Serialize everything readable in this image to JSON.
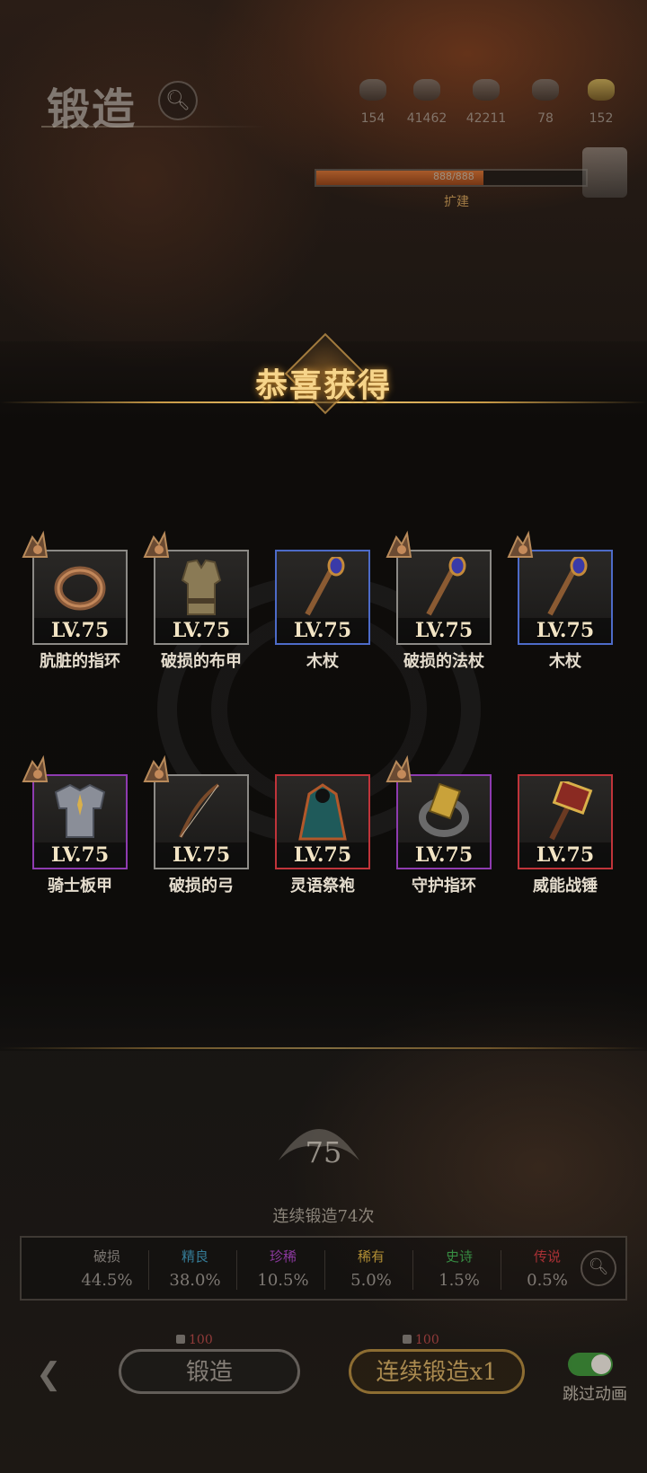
{
  "header": {
    "title": "锻造",
    "resources": [
      {
        "icon": "ore-icon",
        "value": "154"
      },
      {
        "icon": "ingot-icon",
        "value": "41462"
      },
      {
        "icon": "stone-icon",
        "value": "42211"
      },
      {
        "icon": "crystal-icon",
        "value": "78"
      },
      {
        "icon": "gold-icon",
        "value": "152"
      }
    ],
    "progress_text": "888/888",
    "progress_fraction": 0.62,
    "expand_label": "扩建"
  },
  "reward": {
    "title": "恭喜获得",
    "items": [
      {
        "name": "肮脏的指环",
        "level": "LV.75",
        "rarity": "common",
        "icon": "ring-icon"
      },
      {
        "name": "破损的布甲",
        "level": "LV.75",
        "rarity": "common",
        "icon": "cloth-armor-icon"
      },
      {
        "name": "木杖",
        "level": "LV.75",
        "rarity": "rare",
        "icon": "staff-icon"
      },
      {
        "name": "破损的法杖",
        "level": "LV.75",
        "rarity": "common",
        "icon": "staff-icon"
      },
      {
        "name": "木杖",
        "level": "LV.75",
        "rarity": "rare",
        "icon": "staff-icon"
      },
      {
        "name": "骑士板甲",
        "level": "LV.75",
        "rarity": "epic",
        "icon": "plate-armor-icon"
      },
      {
        "name": "破损的弓",
        "level": "LV.75",
        "rarity": "common",
        "icon": "bow-icon"
      },
      {
        "name": "灵语祭袍",
        "level": "LV.75",
        "rarity": "legendary",
        "icon": "robe-icon"
      },
      {
        "name": "守护指环",
        "level": "LV.75",
        "rarity": "epic",
        "icon": "guard-ring-icon"
      },
      {
        "name": "威能战锤",
        "level": "LV.75",
        "rarity": "legendary",
        "icon": "warhammer-icon"
      }
    ]
  },
  "forge": {
    "level": "75",
    "continuous_text": "连续锻造74次",
    "rates": [
      {
        "name": "破损",
        "value": "44.5%",
        "color": "#8f8a84"
      },
      {
        "name": "精良",
        "value": "38.0%",
        "color": "#3a8fb0"
      },
      {
        "name": "珍稀",
        "value": "10.5%",
        "color": "#a03fb8"
      },
      {
        "name": "稀有",
        "value": "5.0%",
        "color": "#c9a23a"
      },
      {
        "name": "史诗",
        "value": "1.5%",
        "color": "#3aa04a"
      },
      {
        "name": "传说",
        "value": "0.5%",
        "color": "#c0343a"
      }
    ],
    "forge_button": "锻造",
    "forge_cost": "100",
    "continuous_button": "连续锻造x1",
    "continuous_cost": "100",
    "skip_label": "跳过动画",
    "skip_enabled": true
  }
}
